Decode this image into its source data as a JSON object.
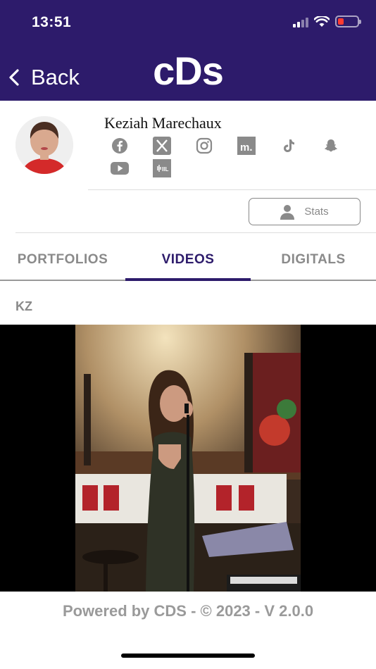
{
  "status_bar": {
    "time": "13:51"
  },
  "header": {
    "back_label": "Back",
    "title": "cDs"
  },
  "profile": {
    "name": "Keziah Marechaux",
    "social_icons": [
      "facebook-icon",
      "x-icon",
      "instagram-icon",
      "models-icon",
      "tiktok-icon",
      "snapchat-icon",
      "youtube-icon",
      "spotlight-icon"
    ],
    "stats_label": "Stats"
  },
  "tabs": [
    {
      "label": "PORTFOLIOS",
      "active": false
    },
    {
      "label": "VIDEOS",
      "active": true
    },
    {
      "label": "DIGITALS",
      "active": false
    }
  ],
  "section": {
    "label": "KZ"
  },
  "footer": {
    "text": "Powered by CDS - © 2023 - V 2.0.0"
  },
  "colors": {
    "brand": "#2d1b6b",
    "battery_low": "#ff3b30",
    "muted": "#8a8a8a"
  }
}
